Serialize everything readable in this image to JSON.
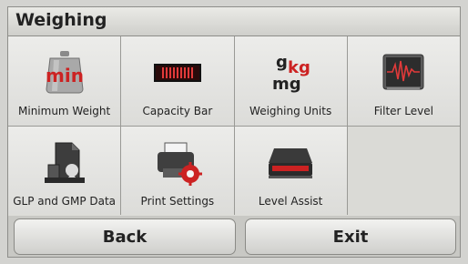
{
  "header": {
    "title": "Weighing"
  },
  "menu": {
    "items": [
      {
        "label": "Minimum Weight",
        "icon": "minimum-weight-icon",
        "icon_text": "min"
      },
      {
        "label": "Capacity Bar",
        "icon": "capacity-bar-icon"
      },
      {
        "label": "Weighing Units",
        "icon": "weighing-units-icon",
        "icon_text_g": "g",
        "icon_text_kg": "kg",
        "icon_text_mg": "mg"
      },
      {
        "label": "Filter Level",
        "icon": "filter-level-icon"
      },
      {
        "label": "GLP and GMP Data",
        "icon": "glp-gmp-data-icon"
      },
      {
        "label": "Print Settings",
        "icon": "print-settings-icon"
      },
      {
        "label": "Level Assist",
        "icon": "level-assist-icon"
      }
    ]
  },
  "footer": {
    "back_label": "Back",
    "exit_label": "Exit"
  },
  "colors": {
    "accent_red": "#cc2222",
    "tile_bg": "#ececea",
    "divider": "#9a9a96"
  }
}
